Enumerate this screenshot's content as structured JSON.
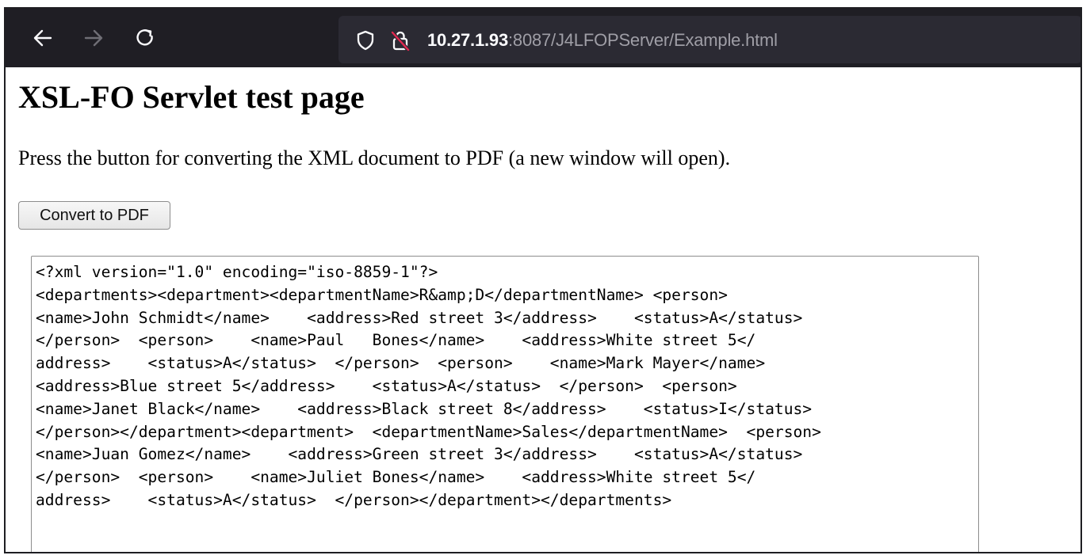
{
  "browser": {
    "icons": {
      "back": "back-arrow-icon",
      "forward": "forward-arrow-icon",
      "reload": "reload-icon",
      "tracking_protection": "shield-icon",
      "connection": "insecure-lock-icon"
    },
    "url": {
      "host": "10.27.1.93",
      "rest": ":8087/J4LFOPServer/Example.html"
    },
    "colors": {
      "toolbar": "#1f1e24",
      "urlbar": "#2b2a33",
      "insecure_slash": "#e22850"
    }
  },
  "page": {
    "title": "XSL-FO Servlet test page",
    "intro": "Press the button for converting the XML document to PDF (a new window will open).",
    "convert_button_label": "Convert to PDF",
    "xml_content": "<?xml version=\"1.0\" encoding=\"iso-8859-1\"?>\n<departments><department><departmentName>R&amp;D</departmentName> <person>\n<name>John Schmidt</name>    <address>Red street 3</address>    <status>A</status>\n</person>  <person>    <name>Paul   Bones</name>    <address>White street 5</\naddress>    <status>A</status>  </person>  <person>    <name>Mark Mayer</name>\n<address>Blue street 5</address>    <status>A</status>  </person>  <person>\n<name>Janet Black</name>    <address>Black street 8</address>    <status>I</status>\n</person></department><department>  <departmentName>Sales</departmentName>  <person>\n<name>Juan Gomez</name>    <address>Green street 3</address>    <status>A</status>\n</person>  <person>    <name>Juliet Bones</name>    <address>White street 5</\naddress>    <status>A</status>  </person></department></departments>"
  }
}
